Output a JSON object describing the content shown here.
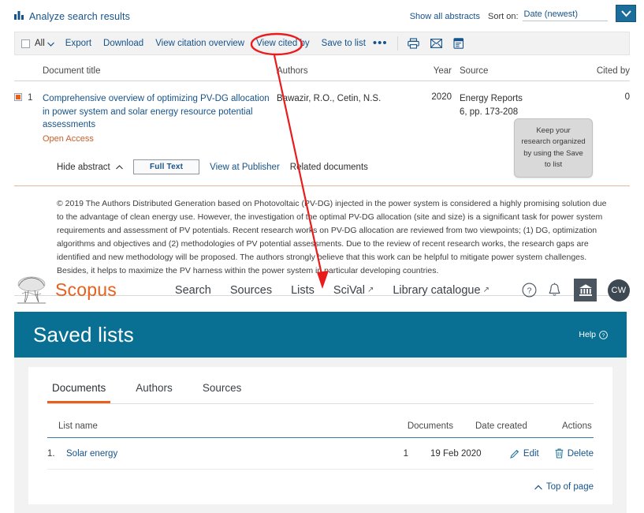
{
  "results": {
    "analyze_link": "Analyze search results",
    "show_all_abstracts": "Show all abstracts",
    "sort_label": "Sort on:",
    "sort_value": "Date (newest)",
    "toolbar": {
      "all_label": "All",
      "export": "Export",
      "download": "Download",
      "view_citation_overview": "View citation overview",
      "view_cited_by": "View cited by",
      "save_to_list": "Save to list",
      "more_dots": "•••"
    },
    "columns": {
      "title": "Document title",
      "authors": "Authors",
      "year": "Year",
      "source": "Source",
      "cited_by": "Cited by"
    },
    "row": {
      "index": "1",
      "title": "Comprehensive overview of optimizing PV-DG allocation in power system and solar energy resource potential assessments",
      "open_access": "Open Access",
      "authors": "Bawazir, R.O., Cetin, N.S.",
      "year": "2020",
      "source_name": "Energy Reports",
      "source_detail": "6, pp. 173-208",
      "cited_by": "0"
    },
    "actions": {
      "hide_abstract": "Hide abstract",
      "full_text": "Full Text",
      "view_at_publisher": "View at Publisher",
      "related_documents": "Related documents"
    },
    "abstract": "© 2019 The Authors Distributed Generation based on Photovoltaic (PV-DG) injected in the power system is considered a highly promising solution due to the advantage of clean energy use. However, the investigation of the optimal PV-DG allocation (site and size) is a significant task for power system requirements and assessment of PV potentials. Recent research works on PV-DG allocation are reviewed from two viewpoints; (1) DG, optimization algorithms and objectives and (2) methodologies of PV potential assessments. Due to the review of recent research works, the research gaps are identified and new methodology will be proposed. The authors strongly believe that this work can be helpful to mitigate power system challenges. Besides, it helps to maximize the PV harness within the power system in particular developing countries."
  },
  "tooltip": {
    "text": "Keep your research organized by using the Save to list"
  },
  "scopus": {
    "brand": "Scopus",
    "nav": [
      {
        "label": "Search",
        "external": ""
      },
      {
        "label": "Sources",
        "external": ""
      },
      {
        "label": "Lists",
        "external": ""
      },
      {
        "label": "SciVal",
        "external": "↗"
      },
      {
        "label": "Library catalogue",
        "external": "↗"
      }
    ],
    "avatar_initials": "CW"
  },
  "saved_lists": {
    "title": "Saved lists",
    "help": "Help",
    "tabs": [
      {
        "label": "Documents",
        "active": true
      },
      {
        "label": "Authors",
        "active": false
      },
      {
        "label": "Sources",
        "active": false
      }
    ],
    "columns": {
      "list_name": "List name",
      "documents": "Documents",
      "date_created": "Date created",
      "actions": "Actions"
    },
    "rows": [
      {
        "index": "1.",
        "name": "Solar energy",
        "documents": "1",
        "date_created": "19 Feb 2020",
        "edit": "Edit",
        "delete": "Delete"
      }
    ],
    "top_of_page": "Top of page"
  },
  "colors": {
    "link": "#16538a",
    "accent_orange": "#e8601c",
    "banner_teal": "#0a7093",
    "annotation_red": "#e81c1c"
  }
}
